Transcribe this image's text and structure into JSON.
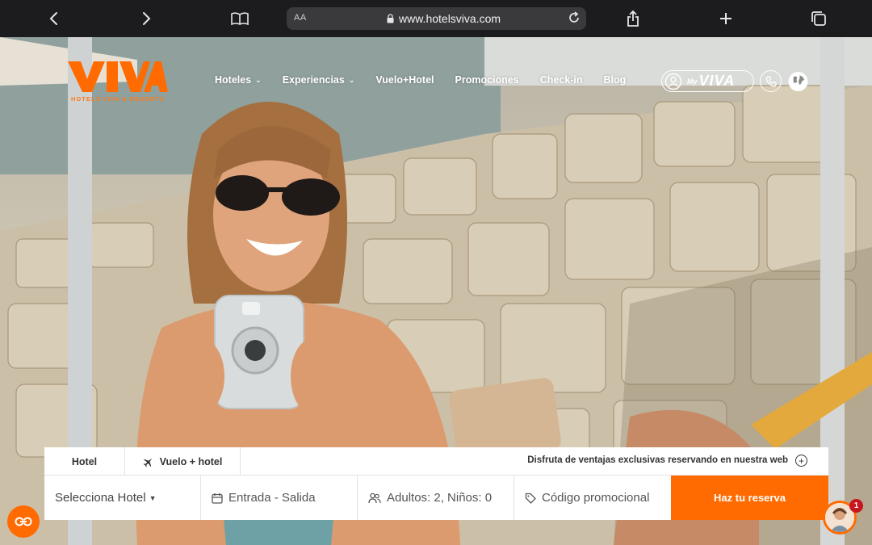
{
  "browser": {
    "text_size_label": "AA",
    "url": "www.hotelsviva.com",
    "icons": [
      "back-icon",
      "forward-icon",
      "bookmarks-icon",
      "lock-icon",
      "reload-icon",
      "share-icon",
      "new-tab-icon",
      "tabs-icon"
    ]
  },
  "site": {
    "logo_text": "VIVA",
    "logo_subtitle": "HOTELS VIVA & RESORTS",
    "brand_color": "#ff6b00",
    "nav": [
      {
        "label": "Hoteles",
        "has_dropdown": true
      },
      {
        "label": "Experiencias",
        "has_dropdown": true
      },
      {
        "label": "Vuelo+Hotel",
        "has_dropdown": false
      },
      {
        "label": "Promociones",
        "has_dropdown": false
      },
      {
        "label": "Check-in",
        "has_dropdown": false
      },
      {
        "label": "Blog",
        "has_dropdown": false
      }
    ],
    "my_viva_label": "VIVA",
    "my_viva_prefix": "My",
    "header_icons": [
      "user-icon",
      "phone-icon",
      "globe-icon"
    ]
  },
  "booking": {
    "tabs": {
      "hotel": "Hotel",
      "vuelo": "Vuelo + hotel"
    },
    "promo_text": "Disfruta de ventajas exclusivas reservando en nuestra web",
    "fields": {
      "hotel": "Selecciona Hotel",
      "dates": "Entrada - Salida",
      "guests": "Adultos: 2, Niños: 0",
      "promo_code": "Código promocional"
    },
    "cta": "Haz tu reserva"
  },
  "floating": {
    "co_label": "CO",
    "chat_badge": "1"
  }
}
